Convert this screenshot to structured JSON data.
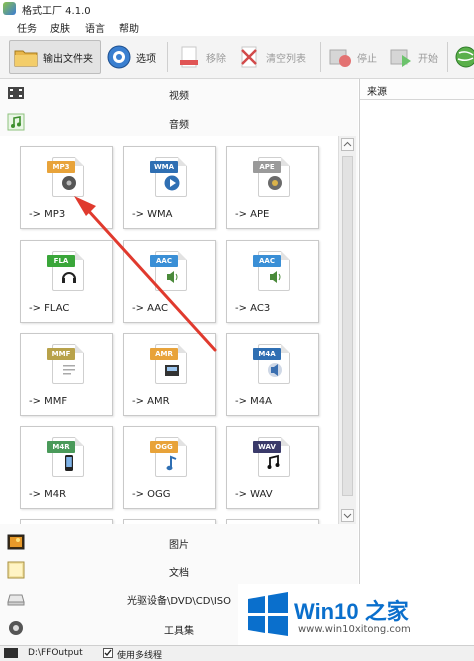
{
  "window": {
    "title": "格式工厂 4.1.0"
  },
  "menu": {
    "items": [
      "任务",
      "皮肤",
      "语言",
      "帮助"
    ]
  },
  "toolbar": {
    "output_folder": "输出文件夹",
    "options": "选项",
    "remove": "移除",
    "clear_list": "清空列表",
    "stop": "停止",
    "start": "开始"
  },
  "categories": {
    "video": "视频",
    "audio": "音频",
    "image": "图片",
    "document": "文档",
    "disc": "光驱设备\\DVD\\CD\\ISO",
    "tools": "工具集"
  },
  "audio_formats": [
    {
      "badge": "MP3",
      "label": "-> MP3",
      "color": "#e8a33a"
    },
    {
      "badge": "WMA",
      "label": "-> WMA",
      "color": "#2f6fb3"
    },
    {
      "badge": "APE",
      "label": "-> APE",
      "color": "#9a9a9a"
    },
    {
      "badge": "FLA",
      "label": "-> FLAC",
      "color": "#3aa63a"
    },
    {
      "badge": "AAC",
      "label": "-> AAC",
      "color": "#3a8fd6"
    },
    {
      "badge": "AAC",
      "label": "-> AC3",
      "color": "#3a8fd6"
    },
    {
      "badge": "MMF",
      "label": "-> MMF",
      "color": "#b8a24a"
    },
    {
      "badge": "AMR",
      "label": "-> AMR",
      "color": "#e8a33a"
    },
    {
      "badge": "M4A",
      "label": "-> M4A",
      "color": "#2f6fb3"
    },
    {
      "badge": "M4R",
      "label": "-> M4R",
      "color": "#4a9a5a"
    },
    {
      "badge": "OGG",
      "label": "-> OGG",
      "color": "#e8a33a"
    },
    {
      "badge": "WAV",
      "label": "-> WAV",
      "color": "#3a3a6a"
    }
  ],
  "right_panel": {
    "header": "来源"
  },
  "status": {
    "output_path": "D:\\FFOutput",
    "multithread_label": "使用多线程"
  },
  "watermark": {
    "title": "Win10 之家",
    "url": "www.win10xitong.com"
  },
  "colors": {
    "annotation_arrow": "#e03a2e",
    "watermark_blue": "#0a6fcc"
  }
}
